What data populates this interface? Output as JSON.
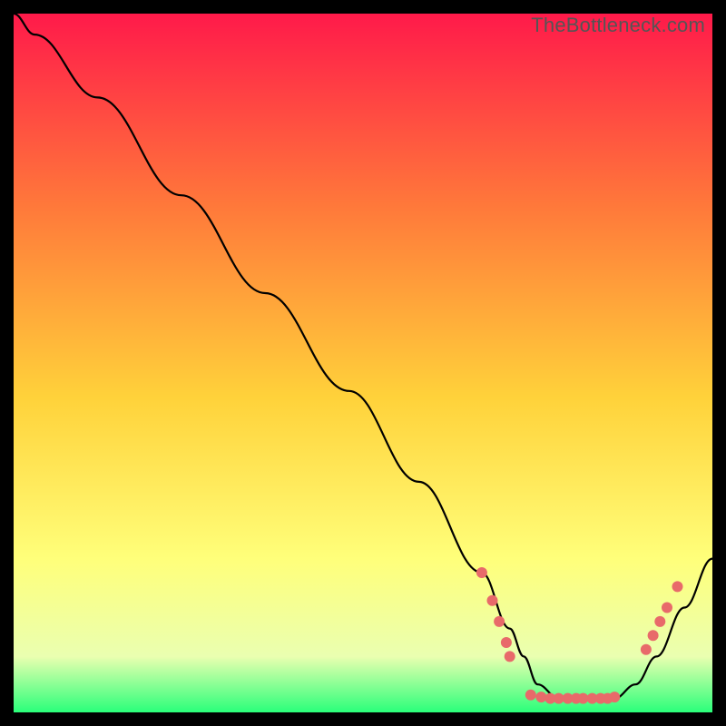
{
  "watermark": "TheBottleneck.com",
  "chart_data": {
    "type": "line",
    "title": "",
    "xlabel": "",
    "ylabel": "",
    "xlim": [
      0,
      100
    ],
    "ylim": [
      0,
      100
    ],
    "background_gradient": {
      "top": "#ff1a4a",
      "mid_high": "#ff7a3a",
      "mid": "#ffd23a",
      "mid_low": "#ffff7a",
      "near_bottom": "#eaffb0",
      "bottom": "#2aff7a"
    },
    "series": [
      {
        "name": "bottleneck-curve",
        "x": [
          0,
          3,
          12,
          24,
          36,
          48,
          58,
          67,
          71,
          73,
          75,
          78,
          82,
          86,
          89,
          92,
          96,
          100
        ],
        "y": [
          100,
          97,
          88,
          74,
          60,
          46,
          33,
          20,
          12,
          8,
          4,
          2,
          2,
          2,
          4,
          8,
          15,
          22
        ]
      }
    ],
    "markers": {
      "name": "highlight-dots",
      "color": "#e86a6a",
      "points": [
        {
          "x": 67,
          "y": 20
        },
        {
          "x": 68.5,
          "y": 16
        },
        {
          "x": 69.5,
          "y": 13
        },
        {
          "x": 70.5,
          "y": 10
        },
        {
          "x": 71,
          "y": 8
        },
        {
          "x": 74,
          "y": 2.5
        },
        {
          "x": 75.5,
          "y": 2.2
        },
        {
          "x": 76.8,
          "y": 2
        },
        {
          "x": 78,
          "y": 2
        },
        {
          "x": 79.3,
          "y": 2
        },
        {
          "x": 80.5,
          "y": 2
        },
        {
          "x": 81.5,
          "y": 2
        },
        {
          "x": 82.8,
          "y": 2
        },
        {
          "x": 84,
          "y": 2
        },
        {
          "x": 85,
          "y": 2
        },
        {
          "x": 86,
          "y": 2.2
        },
        {
          "x": 90.5,
          "y": 9
        },
        {
          "x": 91.5,
          "y": 11
        },
        {
          "x": 92.5,
          "y": 13
        },
        {
          "x": 93.5,
          "y": 15
        },
        {
          "x": 95,
          "y": 18
        }
      ]
    }
  }
}
